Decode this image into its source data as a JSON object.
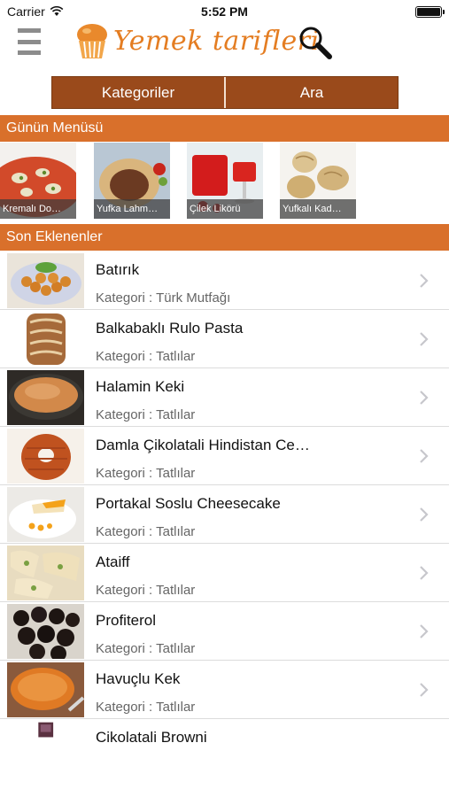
{
  "status_bar": {
    "carrier": "Carrier",
    "time": "5:52 PM",
    "battery_level": 1.0
  },
  "header": {
    "app_title": "Yemek tarifleri",
    "menu_icon": "hamburger-menu-icon",
    "search_icon": "search-icon"
  },
  "segments": [
    {
      "label": "Kategoriler"
    },
    {
      "label": "Ara"
    }
  ],
  "section_menu": {
    "title": "Günün Menüsü"
  },
  "menu_items": [
    {
      "caption": "Kremalı Do…"
    },
    {
      "caption": "Yufka Lahm…"
    },
    {
      "caption": "Çilek Likörü"
    },
    {
      "caption": "Yufkalı Kad…"
    }
  ],
  "section_recent": {
    "title": "Son Eklenenler"
  },
  "recent": [
    {
      "title": "Batırık",
      "category": "Kategori : Türk Mutfağı"
    },
    {
      "title": "Balkabaklı Rulo Pasta",
      "category": "Kategori : Tatlılar"
    },
    {
      "title": "Halamin Keki",
      "category": "Kategori : Tatlılar"
    },
    {
      "title": "Damla Çikolatali Hindistan Ce…",
      "category": "Kategori : Tatlılar"
    },
    {
      "title": "Portakal Soslu Cheesecake",
      "category": "Kategori : Tatlılar"
    },
    {
      "title": "Ataiff",
      "category": "Kategori : Tatlılar"
    },
    {
      "title": "Profiterol",
      "category": "Kategori : Tatlılar"
    },
    {
      "title": "Havuçlu Kek",
      "category": "Kategori : Tatlılar"
    },
    {
      "title": "Cikolatali Browni",
      "category": ""
    }
  ],
  "colors": {
    "accent_orange": "#d9702b",
    "segment_brown": "#9a4a1b",
    "logo_orange": "#e47d22"
  }
}
